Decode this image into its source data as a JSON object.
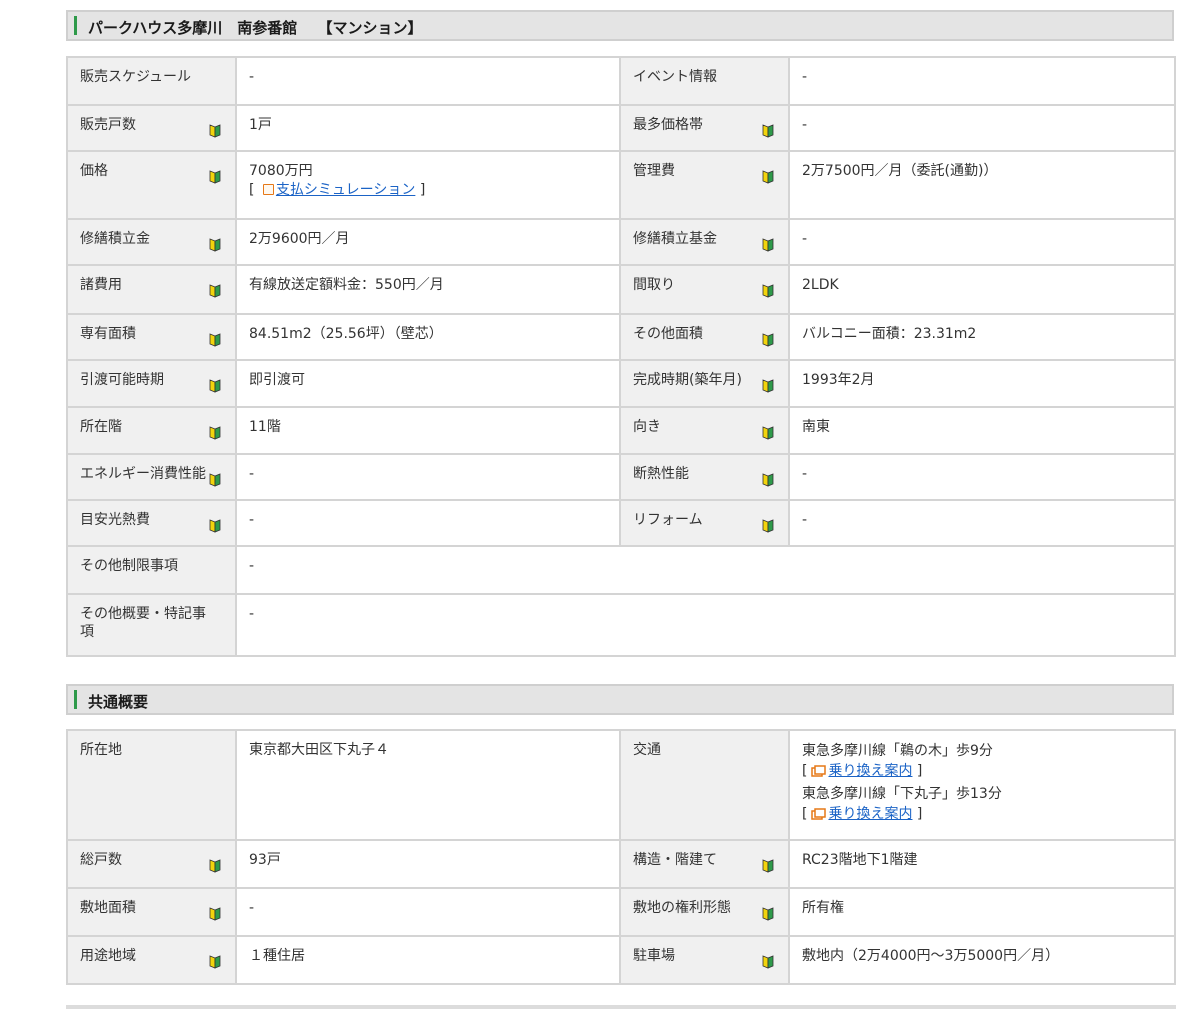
{
  "property": {
    "title": "パークハウス多摩川　南参番館　 【マンション】",
    "rows": [
      {
        "l1": "販売スケジュール",
        "v1": "-",
        "l2": "イベント情報",
        "v2": "-"
      },
      {
        "l1": "販売戸数",
        "v1": "1戸",
        "l2": "最多価格帯",
        "v2": "-"
      },
      {
        "l1": "価格",
        "v1": "7080万円",
        "l2": "管理費",
        "v2": "2万7500円／月（委託(通勤)）"
      },
      {
        "l1": "修繕積立金",
        "v1": "2万9600円／月",
        "l2": "修繕積立基金",
        "v2": "-"
      },
      {
        "l1": "諸費用",
        "v1": "有線放送定額料金：550円／月",
        "l2": "間取り",
        "v2": "2LDK"
      },
      {
        "l1": "専有面積",
        "v1": "84.51m2（25.56坪）（壁芯）",
        "l2": "その他面積",
        "v2": "バルコニー面積：23.31m2"
      },
      {
        "l1": "引渡可能時期",
        "v1": "即引渡可",
        "l2": "完成時期(築年月)",
        "v2": "1993年2月"
      },
      {
        "l1": "所在階",
        "v1": "11階",
        "l2": "向き",
        "v2": "南東"
      },
      {
        "l1": "エネルギー消費性能",
        "v1": "-",
        "l2": "断熱性能",
        "v2": "-"
      },
      {
        "l1": "目安光熱費",
        "v1": "-",
        "l2": "リフォーム",
        "v2": "-"
      }
    ],
    "payment_link": "支払シミュレーション",
    "other_restrictions_label": "その他制限事項",
    "other_restrictions_value": "-",
    "other_notes_label": "その他概要・特記事項",
    "other_notes_value": "-"
  },
  "common": {
    "title": "共通概要",
    "address_label": "所在地",
    "address_value": "東京都大田区下丸子４",
    "transport_label": "交通",
    "transport": [
      {
        "text": "東急多摩川線「鵜の木」歩9分",
        "link": "乗り換え案内"
      },
      {
        "text": "東急多摩川線「下丸子」歩13分",
        "link": "乗り換え案内"
      }
    ],
    "rows": [
      {
        "l1": "総戸数",
        "v1": "93戸",
        "l2": "構造・階建て",
        "v2": "RC23階地下1階建"
      },
      {
        "l1": "敷地面積",
        "v1": "-",
        "l2": "敷地の権利形態",
        "v2": "所有権"
      },
      {
        "l1": "用途地域",
        "v1": "１種住居",
        "l2": "駐車場",
        "v2": "敷地内（2万4000円～3万5000円／月）"
      }
    ]
  },
  "colors": {
    "accent_bar": "#2e9a4a",
    "link": "#1b63c6",
    "icon_orange": "#e67817"
  },
  "icons": {
    "help": "beginner-mark-icon",
    "payment": "calculator-icon",
    "transit": "train-icon"
  }
}
